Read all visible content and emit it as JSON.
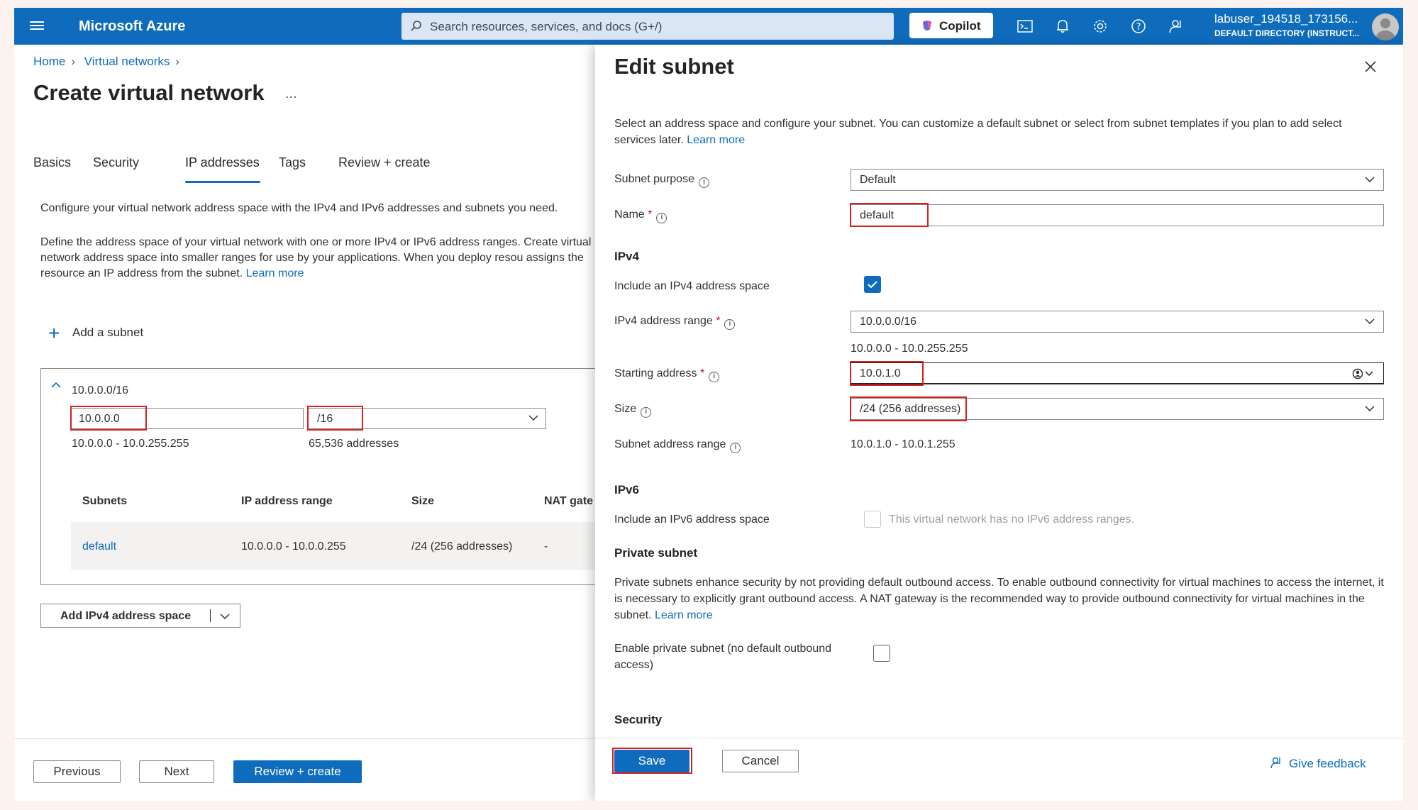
{
  "topbar": {
    "brand": "Microsoft Azure",
    "search_placeholder": "Search resources, services, and docs (G+/)",
    "copilot_label": "Copilot",
    "icons": [
      "cloud-shell-icon",
      "bell-icon",
      "gear-icon",
      "help-icon",
      "feedback-icon"
    ],
    "user_name": "labuser_194518_173156...",
    "user_directory": "DEFAULT DIRECTORY (INSTRUCT..."
  },
  "breadcrumb": {
    "home": "Home",
    "virtual_networks": "Virtual networks"
  },
  "page": {
    "title": "Create virtual network",
    "more": "...",
    "tabs": [
      "Basics",
      "Security",
      "IP addresses",
      "Tags",
      "Review + create"
    ],
    "active_tab": "IP addresses",
    "desc1": "Configure your virtual network address space with the IPv4 and IPv6 addresses and subnets you need.",
    "desc2": "Define the address space of your virtual network with one or more IPv4 or IPv6 address ranges. Create virtual network address space into smaller ranges for use by your applications. When you deploy resou assigns the resource an IP address from the subnet.",
    "learn_more": "Learn more",
    "add_subnet": "Add a subnet"
  },
  "address_space": {
    "header": "10.0.0.0/16",
    "start_value": "10.0.0.0",
    "prefix_value": "/16",
    "range_text": "10.0.0.0 - 10.0.255.255",
    "count_text": "65,536 addresses",
    "columns": [
      "Subnets",
      "IP address range",
      "Size",
      "NAT gate"
    ],
    "rows": [
      {
        "name": "default",
        "range": "10.0.0.0 - 10.0.0.255",
        "size": "/24 (256 addresses)",
        "nat": "-"
      }
    ]
  },
  "add_ipv4_label": "Add IPv4 address space",
  "footer": {
    "previous": "Previous",
    "next": "Next",
    "review": "Review + create"
  },
  "panel": {
    "title": "Edit subnet",
    "description": "Select an address space and configure your subnet. You can customize a default subnet or select from subnet templates if you plan to add select services later.",
    "learn_more": "Learn more",
    "subnet_purpose_label": "Subnet purpose",
    "subnet_purpose_value": "Default",
    "name_label": "Name",
    "name_value": "default",
    "ipv4_section": "IPv4",
    "include_ipv4_label": "Include an IPv4 address space",
    "include_ipv4_checked": true,
    "ipv4_range_label": "IPv4 address range",
    "ipv4_range_value": "10.0.0.0/16",
    "ipv4_range_text": "10.0.0.0 - 10.0.255.255",
    "starting_address_label": "Starting address",
    "starting_address_value": "10.0.1.0",
    "size_label": "Size",
    "size_value": "/24 (256 addresses)",
    "subnet_range_label": "Subnet address range",
    "subnet_range_value": "10.0.1.0 - 10.0.1.255",
    "ipv6_section": "IPv6",
    "include_ipv6_label": "Include an IPv6 address space",
    "ipv6_disabled_text": "This virtual network has no IPv6 address ranges.",
    "private_section": "Private subnet",
    "private_text": "Private subnets enhance security by not providing default outbound access. To enable outbound connectivity for virtual machines to access the internet, it is necessary to explicitly grant outbound access. A NAT gateway is the recommended way to provide outbound connectivity for virtual machines in the subnet.",
    "private_learn_more": "Learn more",
    "enable_private_label": "Enable private subnet (no default outbound access)",
    "security_section": "Security",
    "save": "Save",
    "cancel": "Cancel",
    "give_feedback": "Give feedback"
  },
  "colors": {
    "accent": "#0f6cbd",
    "highlight": "#d62020"
  }
}
